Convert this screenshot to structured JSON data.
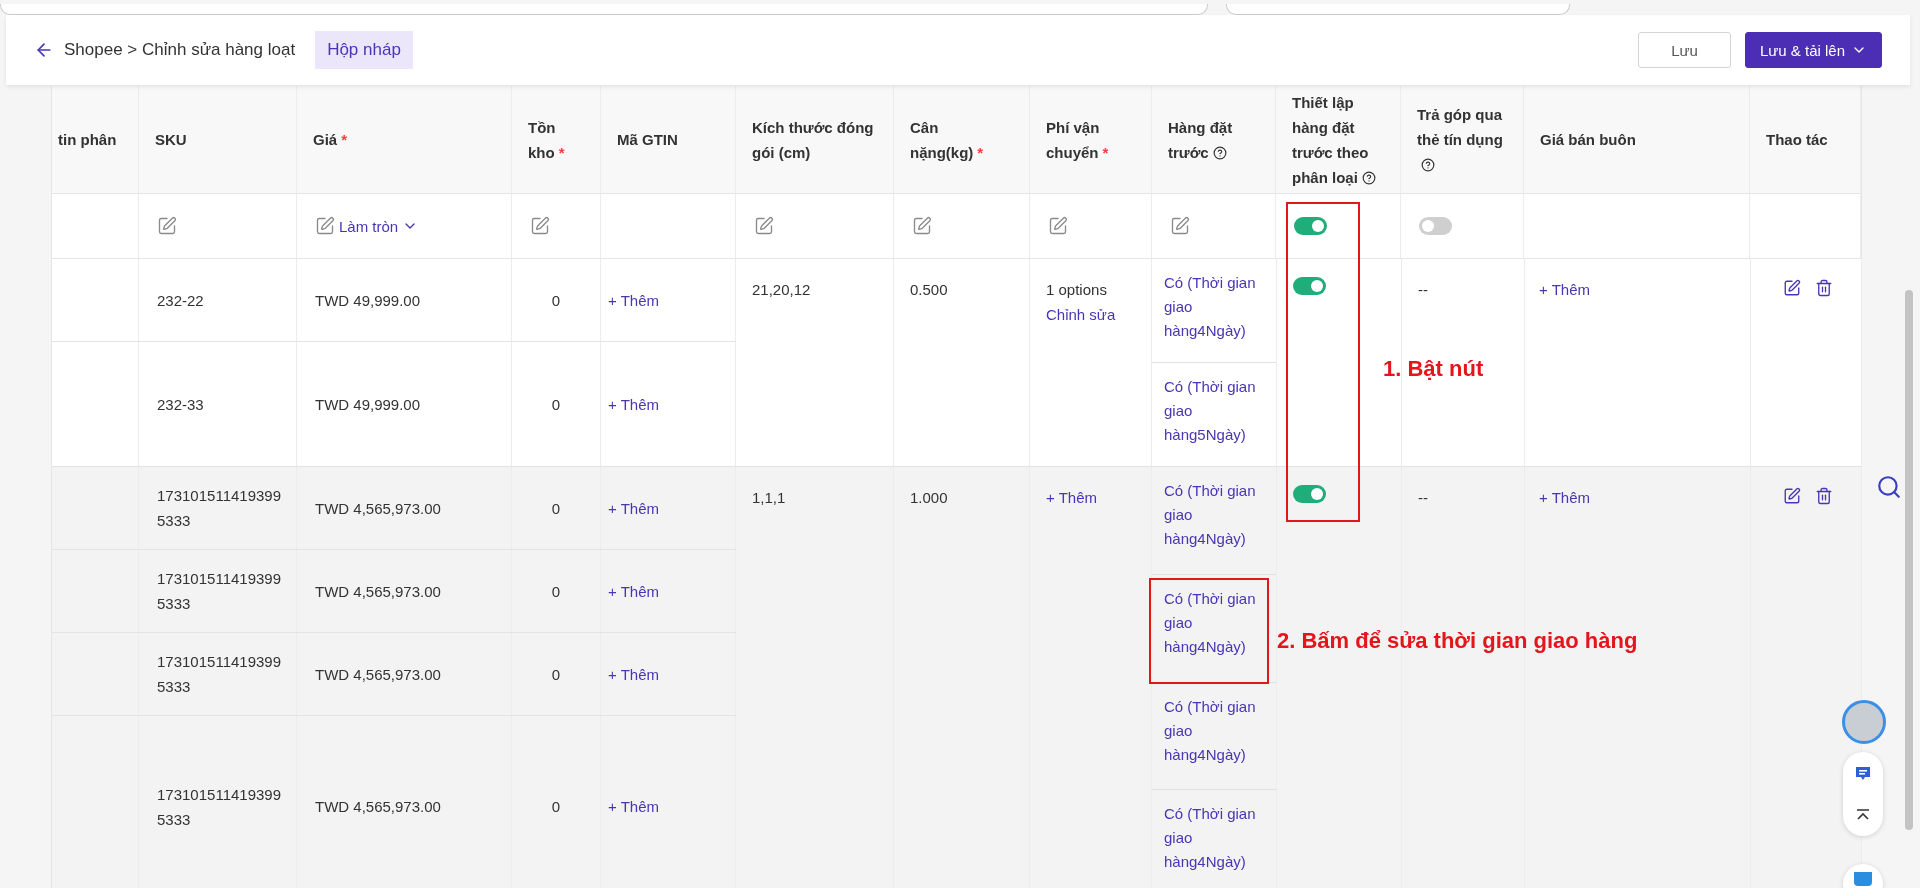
{
  "header": {
    "breadcrumb": "Shopee > Chỉnh sửa hàng loạt",
    "badge": "Hộp nháp",
    "buttons": [
      {
        "label": "Lưu",
        "kind": "secondary"
      },
      {
        "label": "Lưu & tải lên",
        "kind": "primary"
      }
    ]
  },
  "table": {
    "columns": [
      {
        "label": "tin phân"
      },
      {
        "label": "SKU"
      },
      {
        "label": "Giá",
        "required": "*"
      },
      {
        "label": "Tồn kho",
        "required": "*"
      },
      {
        "label": "Mã GTIN"
      },
      {
        "label": "Kích thước đóng gói (cm)"
      },
      {
        "label": "Cân nặng(kg)",
        "required": "*"
      },
      {
        "label": "Phí vận chuyển",
        "required": "*"
      },
      {
        "label": "Hàng đặt trước",
        "help": true
      },
      {
        "label": "Thiết lập hàng đặt trước theo phân loại",
        "help": true
      },
      {
        "label": "Trả góp qua thẻ tín dụng",
        "help": true
      },
      {
        "label": "Giá bán buôn"
      },
      {
        "label": "Thao tác"
      }
    ],
    "bulk_row": [
      {
        "kind": "empty"
      },
      {
        "kind": "edit"
      },
      {
        "kind": "edit_round",
        "label": "Làm tròn"
      },
      {
        "kind": "edit"
      },
      {
        "kind": "empty"
      },
      {
        "kind": "edit"
      },
      {
        "kind": "edit"
      },
      {
        "kind": "edit"
      },
      {
        "kind": "edit"
      },
      {
        "kind": "toggle",
        "on": true
      },
      {
        "kind": "toggle",
        "on": false
      },
      {
        "kind": "empty"
      },
      {
        "kind": "empty"
      }
    ],
    "groups": [
      {
        "highlighted": false,
        "variants": [
          {
            "sku": "232-22",
            "price": "TWD 49,999.00",
            "stock": "0",
            "gtin": "+ Thêm"
          },
          {
            "sku": "232-33",
            "price": "TWD 49,999.00",
            "stock": "0",
            "gtin": "+ Thêm"
          }
        ],
        "size": "21,20,12",
        "weight": "0.500",
        "shipping": {
          "text": "1 options",
          "link": "Chỉnh sửa"
        },
        "preorder": [
          "Có (Thời gian giao hàng4Ngày)",
          "Có (Thời gian giao hàng5Ngày)"
        ],
        "preorder_by_variant_on": true,
        "installment": "--",
        "wholesale": "+ Thêm"
      },
      {
        "highlighted": true,
        "variants": [
          {
            "sku": "1731015114193995333",
            "price": "TWD 4,565,973.00",
            "stock": "0",
            "gtin": "+ Thêm"
          },
          {
            "sku": "1731015114193995333",
            "price": "TWD 4,565,973.00",
            "stock": "0",
            "gtin": "+ Thêm"
          },
          {
            "sku": "1731015114193995333",
            "price": "TWD 4,565,973.00",
            "stock": "0",
            "gtin": "+ Thêm"
          },
          {
            "sku": "1731015114193995333",
            "price": "TWD 4,565,973.00",
            "stock": "0",
            "gtin": "+ Thêm"
          }
        ],
        "size": "1,1,1",
        "weight": "1.000",
        "shipping": {
          "link": "+ Thêm"
        },
        "preorder": [
          "Có (Thời gian giao hàng4Ngày)",
          "Có (Thời gian giao hàng4Ngày)",
          "Có (Thời gian giao hàng4Ngày)",
          "Có (Thời gian giao hàng4Ngày)"
        ],
        "preorder_by_variant_on": true,
        "installment": "--",
        "wholesale": "+ Thêm"
      }
    ]
  },
  "annotations": [
    {
      "label": "1. Bật nút"
    },
    {
      "label": "2. Bấm để sửa thời gian giao hàng"
    }
  ]
}
